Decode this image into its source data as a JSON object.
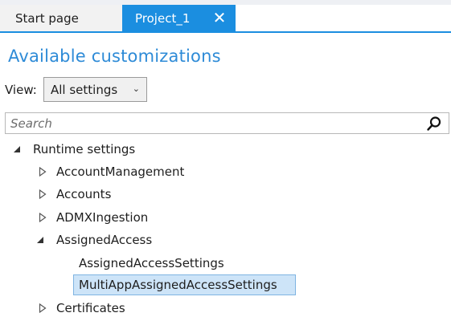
{
  "tabs": [
    {
      "label": "Start page"
    },
    {
      "label": "Project_1",
      "close_glyph": "✕"
    }
  ],
  "title": "Available customizations",
  "view": {
    "label": "View:",
    "selected": "All settings",
    "chevron": "⌄"
  },
  "search": {
    "placeholder": "Search"
  },
  "tree": {
    "root": {
      "label": "Runtime settings"
    },
    "items": [
      {
        "label": "AccountManagement"
      },
      {
        "label": "Accounts"
      },
      {
        "label": "ADMXIngestion"
      },
      {
        "label": "AssignedAccess"
      },
      {
        "label": "AssignedAccessSettings"
      },
      {
        "label": "MultiAppAssignedAccessSettings"
      },
      {
        "label": "Certificates"
      }
    ]
  },
  "colors": {
    "accent": "#1b8ee0",
    "title": "#2e8bd7",
    "selection": "#cde4f8"
  }
}
